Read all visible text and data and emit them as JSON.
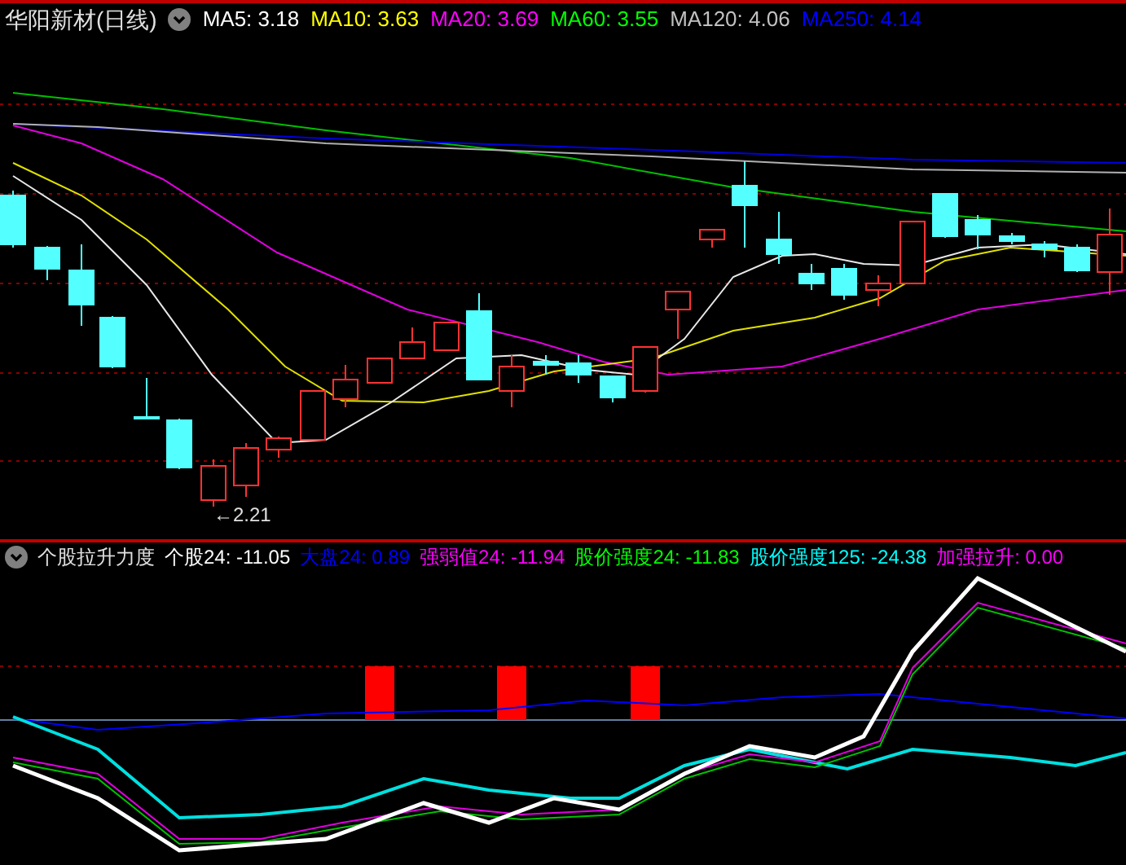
{
  "main_panel": {
    "title": "华阳新材(日线)",
    "ma_readings": [
      {
        "text": "MA5: 3.18",
        "color": "#ffffff"
      },
      {
        "text": "MA10: 3.63",
        "color": "#ffff00"
      },
      {
        "text": "MA20: 3.69",
        "color": "#ff00ff"
      },
      {
        "text": "MA60: 3.55",
        "color": "#00ff00"
      },
      {
        "text": "MA120: 4.06",
        "color": "#c0c0c0"
      },
      {
        "text": "MA250: 4.14",
        "color": "#0000ff"
      }
    ],
    "low_marker": "←2.21"
  },
  "indicator_panel": {
    "title": "个股拉升力度",
    "readings": [
      {
        "text": "个股24: -11.05",
        "color": "#ffffff"
      },
      {
        "text": "大盘24: 0.89",
        "color": "#0000ff"
      },
      {
        "text": "强弱值24: -11.94",
        "color": "#ff00ff"
      },
      {
        "text": "股价强度24: -11.83",
        "color": "#00ff00"
      },
      {
        "text": "股价强度125: -24.38",
        "color": "#00ffff"
      },
      {
        "text": "加强拉升: 0.00",
        "color": "#ff00ff"
      }
    ]
  }
}
